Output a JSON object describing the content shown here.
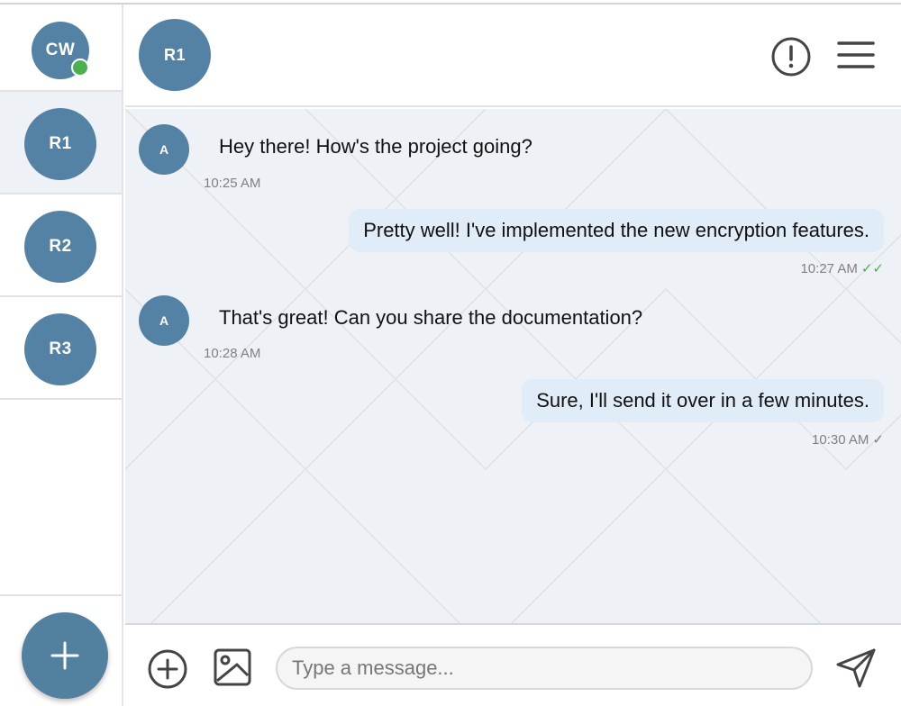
{
  "current_user": {
    "initials": "CW",
    "status": "online"
  },
  "rooms": [
    {
      "initials": "R1",
      "active": true
    },
    {
      "initials": "R2",
      "active": false
    },
    {
      "initials": "R3",
      "active": false
    }
  ],
  "header": {
    "room_initials": "R1",
    "info_icon": "info-icon",
    "menu_icon": "hamburger-menu-icon"
  },
  "messages": [
    {
      "direction": "incoming",
      "sender_initial": "A",
      "text": "Hey there! How's the project going?",
      "time": "10:25 AM"
    },
    {
      "direction": "outgoing",
      "text": "Pretty well! I've implemented the new encryption features.",
      "time": "10:27 AM",
      "ticks": "✓✓",
      "tick_state": "read"
    },
    {
      "direction": "incoming",
      "sender_initial": "A",
      "text": "That's great! Can you share the documentation?",
      "time": "10:28 AM"
    },
    {
      "direction": "outgoing",
      "text": "Sure, I'll send it over in a few minutes.",
      "time": "10:30 AM",
      "ticks": "✓",
      "tick_state": "sent"
    }
  ],
  "composer": {
    "placeholder": "Type a message...",
    "value": ""
  },
  "colors": {
    "accent": "#5482a5",
    "outgoing_bubble": "#e0ecf8",
    "online": "#4caf50",
    "read_tick": "#4caf50",
    "chat_bg": "#eef2f7"
  }
}
